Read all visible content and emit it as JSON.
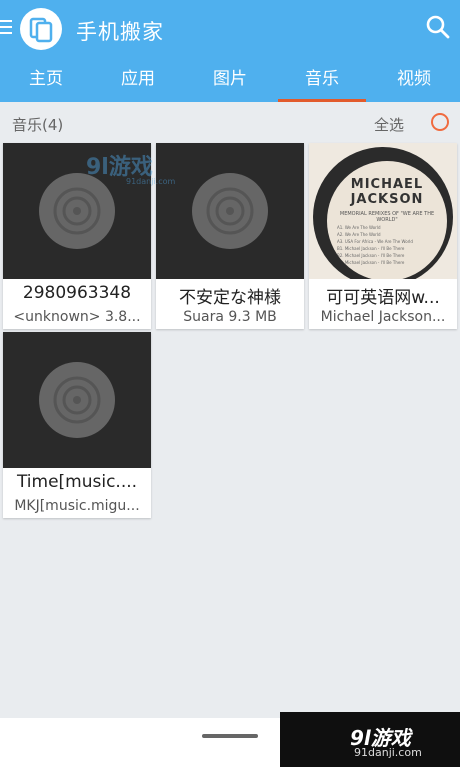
{
  "app": {
    "title": "手机搬家"
  },
  "tabs": [
    {
      "label": "主页",
      "active": false
    },
    {
      "label": "应用",
      "active": false
    },
    {
      "label": "图片",
      "active": false
    },
    {
      "label": "音乐",
      "active": true
    },
    {
      "label": "视频",
      "active": false
    }
  ],
  "section": {
    "title": "音乐(4)",
    "select_all": "全选"
  },
  "items": [
    {
      "name": "2980963348",
      "sub": "<unknown> 3.8...",
      "thumb": "vinyl-placeholder"
    },
    {
      "name": "不安定な神様",
      "sub": "Suara 9.3 MB",
      "thumb": "vinyl-placeholder"
    },
    {
      "name": "可可英语网w...",
      "sub": "Michael Jackson...",
      "thumb": "album-art"
    },
    {
      "name": "Time[music....",
      "sub": "MKJ[music.migu...",
      "thumb": "vinyl-placeholder"
    }
  ],
  "album_art": {
    "line1": "MICHAEL",
    "line2": "JACKSON",
    "line3": "MEMORIAL REMIXES OF \"WE ARE THE WORLD\"",
    "tracks": [
      "A1. We Are The World",
      "A2. We Are The World",
      "A3. USA For Africa - We Are The World",
      "B1. Michael Jackson - I'll Be There",
      "B2. Michael Jackson - I'll Be There",
      "B3. Michael Jackson - I'll Be There"
    ]
  },
  "watermark": {
    "logo": "9l游戏",
    "url": "91danji.com"
  },
  "colors": {
    "appbar": "#4fb0ee",
    "active_tab_indicator": "#e25b2c",
    "radio": "#f06b3f"
  }
}
